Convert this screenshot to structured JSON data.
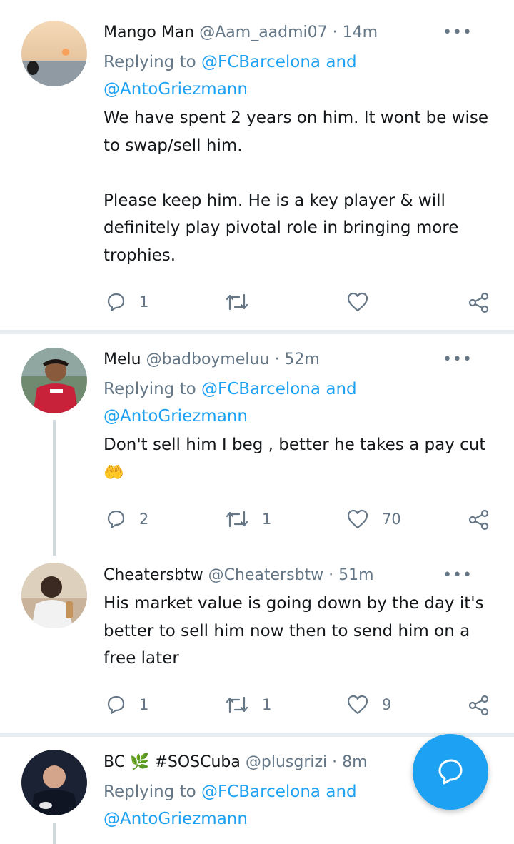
{
  "colors": {
    "accent": "#1da1f2",
    "muted": "#657786",
    "text": "#14171a",
    "divider": "#e6ecf0"
  },
  "tweets": [
    {
      "name": "Mango Man",
      "handle": "@Aam_aadmi07",
      "time": "14m",
      "replying_prefix": "Replying to",
      "replying_to_1": "@FCBarcelona",
      "replying_and": "and",
      "replying_to_2": "@AntoGriezmann",
      "text": "We have spent 2 years on him. It wont be wise to swap/sell him.\n\nPlease keep him. He is a key player & will definitely play pivotal role in bringing more trophies.",
      "replies": "1",
      "retweets": "",
      "likes": ""
    },
    {
      "name": "Melu",
      "handle": "@badboymeluu",
      "time": "52m",
      "replying_prefix": "Replying to",
      "replying_to_1": "@FCBarcelona",
      "replying_and": "and",
      "replying_to_2": "@AntoGriezmann",
      "text": "Don't sell him I beg , better he takes a pay cut 🤲",
      "replies": "2",
      "retweets": "1",
      "likes": "70"
    },
    {
      "name": "Cheatersbtw",
      "handle": "@Cheatersbtw",
      "time": "51m",
      "text": "His market value is going down by the day it's better to sell him now then to send him on a free later",
      "replies": "1",
      "retweets": "1",
      "likes": "9"
    },
    {
      "name": "BC 🌿 #SOSCuba",
      "handle": "@plusgrizi",
      "time": "8m",
      "replying_prefix": "Replying to",
      "replying_to_1": "@FCBarcelona",
      "replying_and": "and",
      "replying_to_2": "@AntoGriezmann"
    }
  ],
  "more_glyph": "•••",
  "dot": "·",
  "icons": [
    "reply-icon",
    "retweet-icon",
    "like-icon",
    "share-icon",
    "more-icon",
    "compose-reply-icon"
  ]
}
